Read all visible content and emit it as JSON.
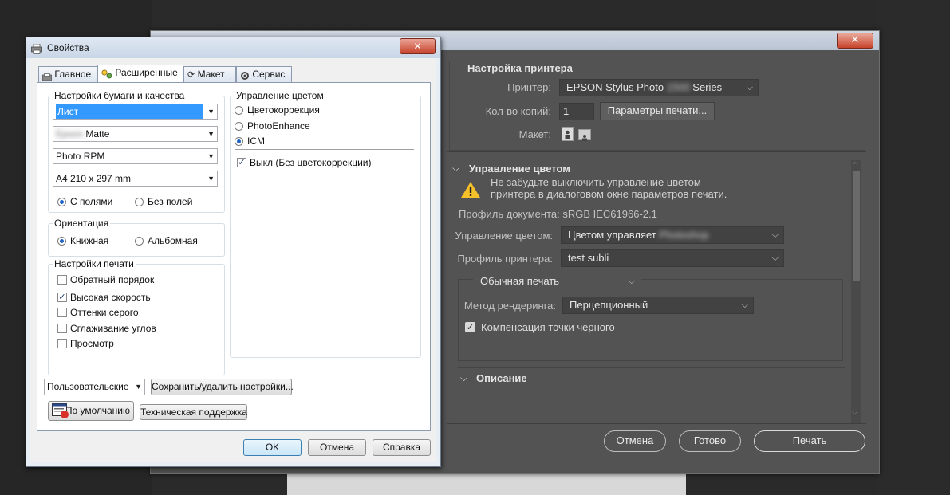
{
  "print_dialog": {
    "close_glyph": "✕",
    "section_printer_setup": "Настройка принтера",
    "printer_label": "Принтер:",
    "printer_value_prefix": "EPSON Stylus Photo",
    "printer_value_blur": "1500",
    "printer_value_suffix": "Series",
    "copies_label": "Кол-во копий:",
    "copies_value": "1",
    "print_settings_button": "Параметры печати...",
    "layout_label": "Макет:",
    "color_management_header": "Управление цветом",
    "warning_line1": "Не забудьте выключить управление цветом",
    "warning_line2": "принтера в диалоговом окне параметров печати.",
    "document_profile": "Профиль документа: sRGB IEC61966-2.1",
    "color_handling_label": "Управление цветом:",
    "color_handling_value": "Цветом управляет",
    "color_handling_blur": "Photoshop",
    "printer_profile_label": "Профиль принтера:",
    "printer_profile_value": "test subli",
    "print_mode_value": "Обычная печать",
    "rendering_label": "Метод рендеринга:",
    "rendering_value": "Перцепционный",
    "black_point_label": "Компенсация точки черного",
    "description_header": "Описание",
    "cancel_button": "Отмена",
    "done_button": "Готово",
    "print_button": "Печать"
  },
  "properties_dialog": {
    "title": "Свойства",
    "tabs": [
      "Главное",
      "Расширенные",
      "Макет",
      "Сервис"
    ],
    "paper_group_title": "Настройки бумаги и качества",
    "paper_source": "Лист",
    "paper_type_blur": "Epson",
    "paper_type": "Matte",
    "quality": "Photo RPM",
    "paper_size": "A4 210 x 297 mm",
    "borders_with": "С полями",
    "borders_without": "Без полей",
    "orientation_title": "Ориентация",
    "portrait": "Книжная",
    "landscape": "Альбомная",
    "print_settings_title": "Настройки печати",
    "reverse_order": "Обратный порядок",
    "high_speed": "Высокая скорость",
    "grayscale": "Оттенки серого",
    "edge_smoothing": "Сглаживание углов",
    "preview": "Просмотр",
    "color_mgmt_title": "Управление цветом",
    "color_correction": "Цветокоррекция",
    "photo_enhance": "PhotoEnhance",
    "icm": "ICM",
    "icm_off": "Выкл (Без цветокоррекции)",
    "custom_settings": "Пользовательские",
    "save_delete_button": "Сохранить/удалить настройки...",
    "defaults_button": "По умолчанию",
    "support_button": "Техническая поддержка",
    "ok_button": "OK",
    "cancel_button": "Отмена",
    "help_button": "Справка",
    "close_glyph": "✕"
  },
  "state": {
    "borders": "with",
    "orientation": "portrait",
    "color_mode": "ICM",
    "icm_off_checked": true,
    "high_speed_checked": true,
    "black_point_checked": true
  }
}
